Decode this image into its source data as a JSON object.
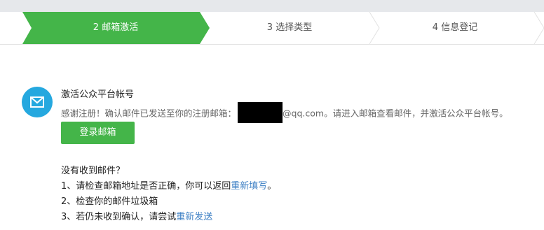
{
  "steps": [
    {
      "label": "2 邮箱激活",
      "state": "active"
    },
    {
      "label": "3 选择类型",
      "state": "inactive"
    },
    {
      "label": "4 信息登记",
      "state": "inactive"
    }
  ],
  "colors": {
    "accent": "#44b549",
    "icon_bg": "#25a8df",
    "link": "#3c7fc4"
  },
  "activation": {
    "icon": "mail-icon",
    "title": "激活公众平台帐号",
    "desc_prefix": "感谢注册！确认邮件已发送至你的注册邮箱：",
    "email_suffix": "@qq.com",
    "desc_suffix": "。请进入邮箱查看邮件，并激活公众平台帐号。",
    "login_button": "登录邮箱"
  },
  "help": {
    "heading": "没有收到邮件？",
    "item1_text": "1、请检查邮箱地址是否正确，你可以返回",
    "item1_link": "重新填写",
    "item1_end": "。",
    "item2_text": "2、检查你的邮件垃圾箱",
    "item3_text": "3、若仍未收到确认，请尝试",
    "item3_link": "重新发送"
  }
}
